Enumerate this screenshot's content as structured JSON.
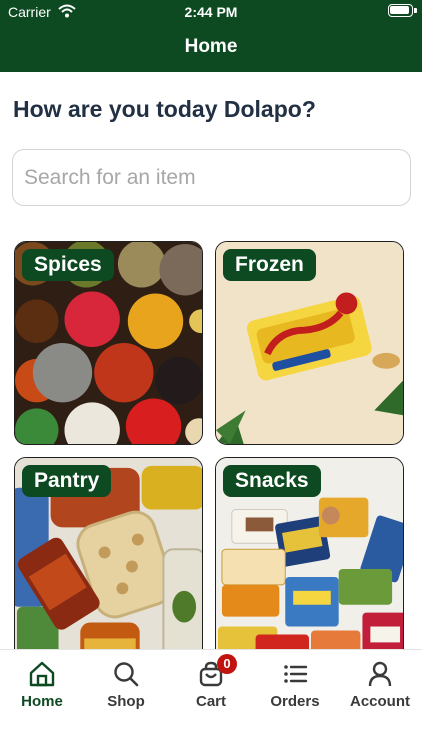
{
  "status_bar": {
    "carrier": "Carrier",
    "time": "2:44 PM"
  },
  "header": {
    "title": "Home"
  },
  "greeting": "How are you today Dolapo?",
  "search": {
    "placeholder": "Search for an item",
    "value": ""
  },
  "categories": [
    {
      "label": "Spices"
    },
    {
      "label": "Frozen"
    },
    {
      "label": "Pantry"
    },
    {
      "label": "Snacks"
    }
  ],
  "tabs": [
    {
      "label": "Home",
      "icon": "home-icon",
      "active": true
    },
    {
      "label": "Shop",
      "icon": "search-icon"
    },
    {
      "label": "Cart",
      "icon": "cart-icon",
      "badge": "0"
    },
    {
      "label": "Orders",
      "icon": "list-icon"
    },
    {
      "label": "Account",
      "icon": "user-icon"
    }
  ],
  "colors": {
    "brand": "#0d4a22",
    "badge": "#c2140f",
    "heading": "#223044"
  }
}
